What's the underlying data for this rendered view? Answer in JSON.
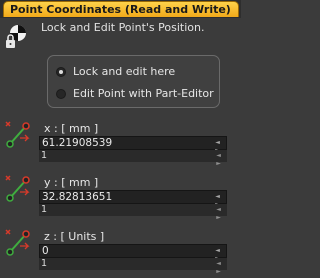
{
  "panel": {
    "title": "Point Coordinates (Read and Write)"
  },
  "lock": {
    "label": "Lock and Edit Point's Position.",
    "options": [
      {
        "label": "Lock and edit here",
        "selected": true
      },
      {
        "label": "Edit Point with Part-Editor",
        "selected": false
      }
    ]
  },
  "coords": [
    {
      "label": "x : [ mm ]",
      "value": "61.21908539",
      "step": "1"
    },
    {
      "label": "y : [ mm ]",
      "value": "32.82813651",
      "step": "1"
    },
    {
      "label": "z : [ Units ]",
      "value": "0",
      "step": "1"
    }
  ],
  "spinner_glyph": "◄ ►",
  "colors": {
    "tab_gradient_top": "#ffd24a",
    "tab_gradient_bottom": "#f1a91a",
    "background": "#3b3b3b",
    "field_bg": "#222222",
    "icon_red": "#d83a2a",
    "icon_green": "#3fae3f"
  },
  "icons": {
    "lock": "lock-icon",
    "coordinate": "point-coordinate-icon"
  }
}
